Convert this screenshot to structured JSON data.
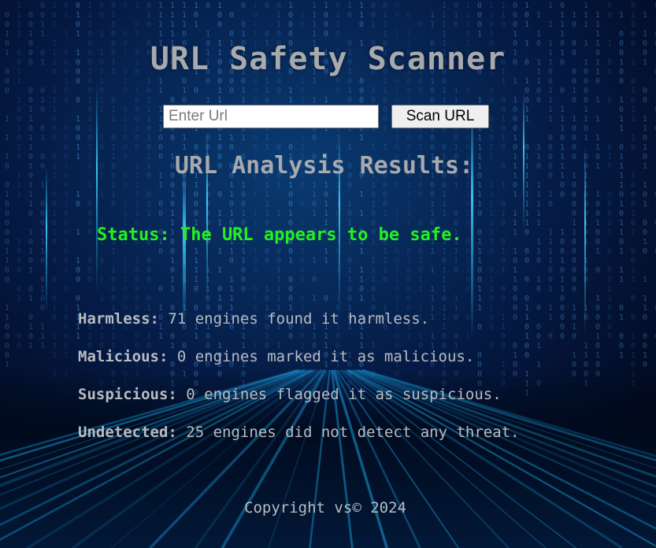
{
  "header": {
    "title": "URL Safety Scanner"
  },
  "search": {
    "value": "",
    "placeholder": "Enter Url",
    "button_label": "Scan URL"
  },
  "results": {
    "heading": "URL Analysis Results:",
    "status": "Status: The URL appears to be safe.",
    "stats": [
      {
        "label": "Harmless:",
        "text": " 71 engines found it harmless."
      },
      {
        "label": "Malicious:",
        "text": " 0 engines marked it as malicious."
      },
      {
        "label": "Suspicious:",
        "text": " 0 engines flagged it as suspicious."
      },
      {
        "label": "Undetected:",
        "text": " 25 engines did not detect any threat."
      }
    ]
  },
  "footer": {
    "copyright": "Copyright vs© 2024"
  },
  "colors": {
    "background": "#020b24",
    "title": "#a6a9ad",
    "status_safe": "#22f022",
    "text": "#b8bcc2",
    "matrix_glow": "#1ec8ff"
  }
}
